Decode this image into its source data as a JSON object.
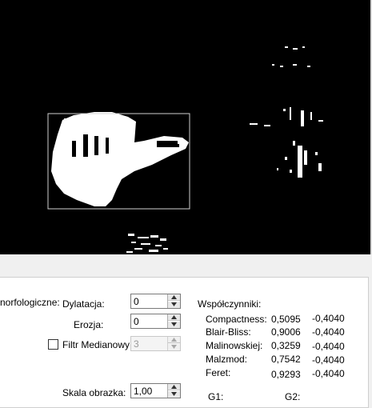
{
  "morph": {
    "section_label": "norfologiczne:",
    "dilation_label": "Dylatacja:",
    "dilation_value": "0",
    "erosion_label": "Erozja:",
    "erosion_value": "0",
    "median_label": "Filtr Medianowy:",
    "median_value": "3",
    "median_checked": false,
    "scale_label": "Skala obrazka:",
    "scale_value": "1,00"
  },
  "coeffs": {
    "title": "Współczynniki:",
    "rows": [
      {
        "name": "Compactness:",
        "v1": "0,5095",
        "v2": "-0,4040"
      },
      {
        "name": "Blair-Bliss:",
        "v1": "0,9006",
        "v2": "-0,4040"
      },
      {
        "name": "Malinowskiej:",
        "v1": "0,3259",
        "v2": "-0,4040"
      },
      {
        "name": "Malzmod:",
        "v1": "0,7542",
        "v2": "-0,4040"
      },
      {
        "name": "Feret:",
        "v1": "0,9293",
        "v2": "-0,4040"
      }
    ],
    "g1_label": "G1:",
    "g2_label": "G2:"
  },
  "icons": [
    "arrow-up-icon",
    "arrow-down-icon"
  ]
}
